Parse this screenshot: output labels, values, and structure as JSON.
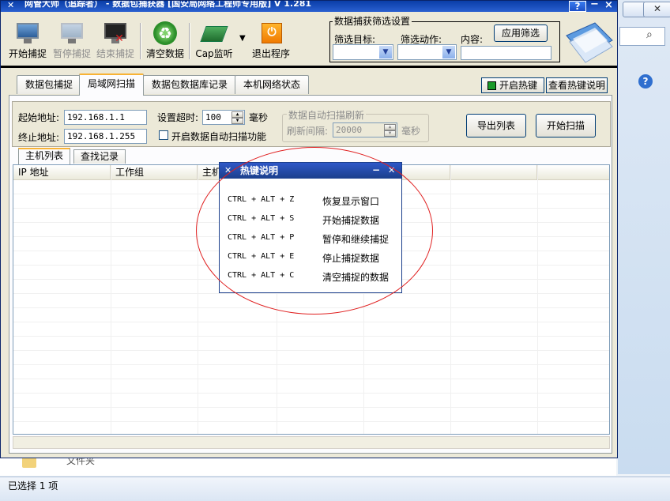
{
  "window": {
    "title": "网管大师（追踪者） - 数据包捕获器 [国安局网络工程师专用版] V 1.281",
    "help_label": "?",
    "minimize_label": "−",
    "close_label": "×"
  },
  "toolbar": {
    "start_capture": "开始捕捉",
    "pause_capture": "暂停捕捉",
    "stop_capture": "结束捕捉",
    "clear_data": "清空数据",
    "cap_monitor": "Cap监听",
    "exit_program": "退出程序"
  },
  "filter": {
    "group_title": "数据捕获筛选设置",
    "target_label": "筛选目标:",
    "action_label": "筛选动作:",
    "content_label": "内容:",
    "target_value": "",
    "action_value": "",
    "content_value": "",
    "apply_button": "应用筛选"
  },
  "main_tabs": [
    "数据包捕捉",
    "局域网扫描",
    "数据包数据库记录",
    "本机网络状态"
  ],
  "hotkeys_panel": {
    "toggle_label": "开启热键",
    "help_button": "查看热键说明"
  },
  "scan": {
    "start_label": "起始地址:",
    "start_value": "192.168.1.1",
    "end_label": "终止地址:",
    "end_value": "192.168.1.255",
    "timeout_label": "设置超时:",
    "timeout_value": "100",
    "timeout_unit": "毫秒",
    "auto_scan_checkbox": "开启数据自动扫描功能",
    "auto_refresh_group": "数据自动扫描刷新",
    "refresh_label": "刷新间隔:",
    "refresh_value": "20000",
    "refresh_unit": "毫秒",
    "export_button": "导出列表",
    "start_scan_button": "开始扫描"
  },
  "sub_tabs": [
    "主机列表",
    "查找记录"
  ],
  "grid": {
    "columns": [
      "IP 地址",
      "工作组",
      "主机",
      "",
      "",
      "",
      ""
    ]
  },
  "dialog": {
    "title": "热键说明",
    "rows": [
      {
        "keys": "CTRL + ALT + Z",
        "desc": "恢复显示窗口"
      },
      {
        "keys": "CTRL + ALT + S",
        "desc": "开始捕捉数据"
      },
      {
        "keys": "CTRL + ALT + P",
        "desc": "暂停和继续捕捉"
      },
      {
        "keys": "CTRL + ALT + E",
        "desc": "停止捕捉数据"
      },
      {
        "keys": "CTRL + ALT + C",
        "desc": "清空捕捉的数据"
      }
    ]
  },
  "explorer": {
    "folder_label": "文件夹",
    "status_text": "已选择 1 项"
  },
  "colors": {
    "titlebar": "#0a3ea8",
    "window_face": "#ece9d8",
    "annotation": "#e02020",
    "active_tab_accent": "#f8b335"
  }
}
